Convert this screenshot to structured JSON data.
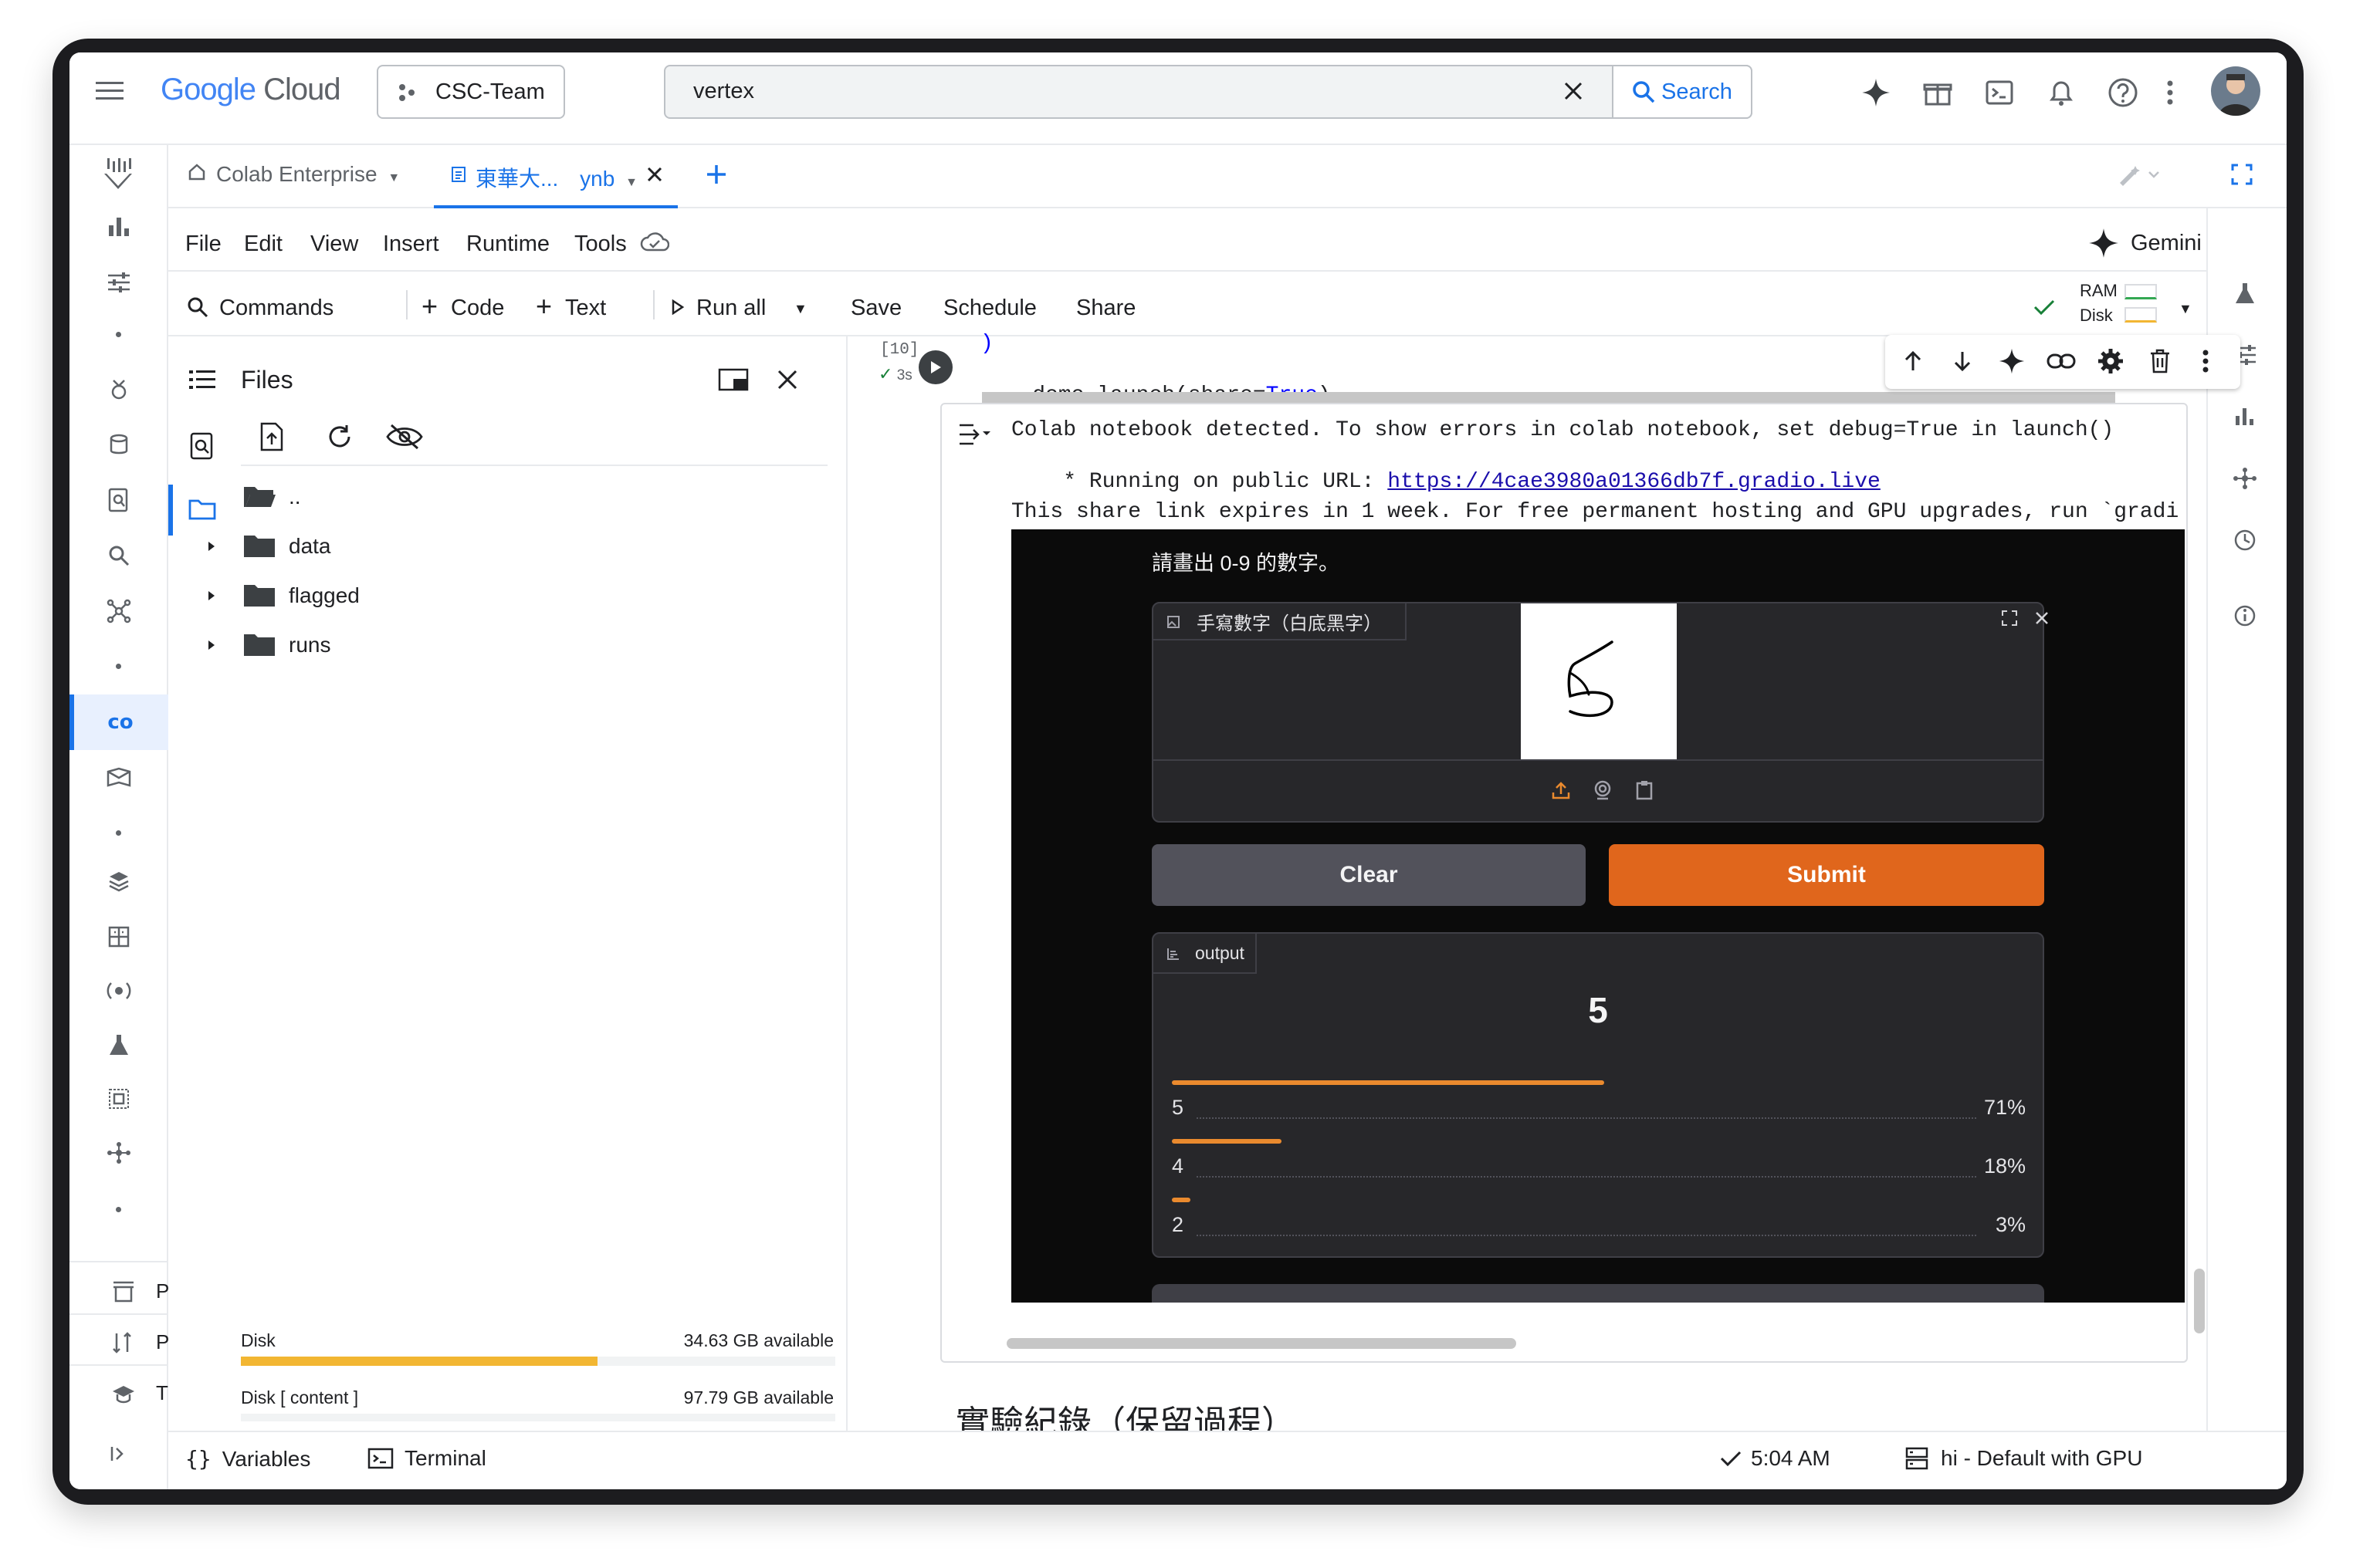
{
  "topbar": {
    "logo_google": "Google",
    "logo_cloud": "Cloud",
    "project": "CSC-Team",
    "search_value": "vertex",
    "search_button": "Search"
  },
  "tabs": {
    "home_label": "Colab Enterprise",
    "notebook_label_a": "東華大...",
    "notebook_label_b": "ynb"
  },
  "menu": {
    "items": [
      "File",
      "Edit",
      "View",
      "Insert",
      "Runtime",
      "Tools"
    ],
    "gemini": "Gemini"
  },
  "toolbar": {
    "commands": "Commands",
    "code": "Code",
    "text": "Text",
    "run_all": "Run all",
    "save": "Save",
    "schedule": "Schedule",
    "share": "Share",
    "ram": "RAM",
    "disk": "Disk"
  },
  "files": {
    "title": "Files",
    "parent": "..",
    "folders": [
      "data",
      "flagged",
      "runs"
    ],
    "disk_label": "Disk",
    "disk_available": "34.63 GB available",
    "disk_fill": 0.6,
    "disk2_label": "Disk [ content ]",
    "disk2_available": "97.79 GB available"
  },
  "cell": {
    "exec_count": "[10]",
    "exec_time": "3s",
    "code_line0": ")",
    "code_prefix": "demo.launch(share=",
    "code_true": "True",
    "code_suffix": ")",
    "out_line1": "Colab notebook detected. To show errors in colab notebook, set debug=True in launch()",
    "out_line2_prefix": "* Running on public URL: ",
    "out_line2_link": "https://4cae3980a01366db7f.gradio.live",
    "out_line3": "This share link expires in 1 week. For free permanent hosting and GPU upgrades, run `gradi"
  },
  "gradio": {
    "description": "請畫出 0-9 的數字。",
    "input_label": "手寫數字（白底黑字）",
    "clear": "Clear",
    "submit": "Submit",
    "output_label": "output",
    "prediction": "5",
    "confidences": [
      {
        "label": "5",
        "pct": "71%",
        "value": 0.71
      },
      {
        "label": "4",
        "pct": "18%",
        "value": 0.18
      },
      {
        "label": "2",
        "pct": "3%",
        "value": 0.03
      }
    ]
  },
  "next_section": "實驗紀錄（保留過程）",
  "bottombar": {
    "variables": "Variables",
    "terminal": "Terminal",
    "time": "5:04 AM",
    "runtime": "hi - Default with GPU"
  },
  "leftnav_labels": [
    "P",
    "P",
    "T"
  ],
  "colors": {
    "accent_blue": "#1a73e8",
    "submit_orange": "#e0661c",
    "bar_orange": "#ea8a2e",
    "disk_yellow": "#f2b632"
  }
}
